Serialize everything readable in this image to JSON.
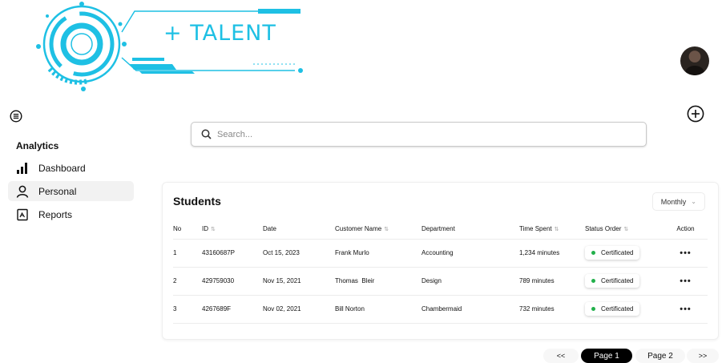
{
  "brand": {
    "name": "+ TALENT",
    "accent": "#1ec0e4"
  },
  "header": {
    "avatar_icon": "user-avatar"
  },
  "sidebar": {
    "heading": "Analytics",
    "items": [
      {
        "label": "Dashboard",
        "icon": "bar-chart-icon",
        "active": false
      },
      {
        "label": "Personal",
        "icon": "user-icon",
        "active": true
      },
      {
        "label": "Reports",
        "icon": "report-icon",
        "active": false
      }
    ]
  },
  "search": {
    "placeholder": "Search...",
    "value": ""
  },
  "students": {
    "title": "Students",
    "period": "Monthly",
    "columns": [
      "No",
      "ID",
      "Date",
      "Customer Name",
      "Department",
      "Time Spent",
      "Status Order",
      "Action"
    ],
    "rows": [
      {
        "no": "1",
        "id": "43160687P",
        "date": "Oct 15, 2023",
        "name": "Frank Murlo",
        "department": "Accounting",
        "time": "1,234 minutes",
        "status": "Certificated"
      },
      {
        "no": "2",
        "id": "429759030",
        "date": "Nov 15, 2021",
        "name": "Thomas  Bleir",
        "department": "Design",
        "time": "789 minutes",
        "status": "Certificated"
      },
      {
        "no": "3",
        "id": "4267689F",
        "date": "Nov 02, 2021",
        "name": "Bill Norton",
        "department": "Chambermaid",
        "time": "732 minutes",
        "status": "Certificated"
      }
    ],
    "status_color": "#22b04b",
    "action_label": "•••"
  },
  "pagination": {
    "prev": "<<",
    "pages": [
      "Page 1",
      "Page 2"
    ],
    "current": "Page 1",
    "next": ">>"
  }
}
